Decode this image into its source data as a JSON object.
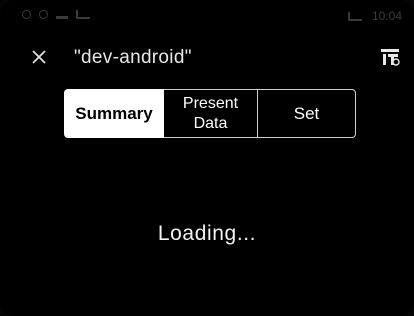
{
  "status_bar": {
    "time": "10:04"
  },
  "header": {
    "title": "\"dev-android\"",
    "close_icon": "close-icon",
    "right_icon": "ttl-icon"
  },
  "tabs": [
    {
      "label": "Summary",
      "selected": true
    },
    {
      "label": "Present\nData",
      "selected": false
    },
    {
      "label": "Set",
      "selected": false
    }
  ],
  "main": {
    "loading_text": "Loading..."
  },
  "colors": {
    "background": "#000000",
    "selected_tab": "#ffffff",
    "tab_border": "#d0d0d0"
  }
}
